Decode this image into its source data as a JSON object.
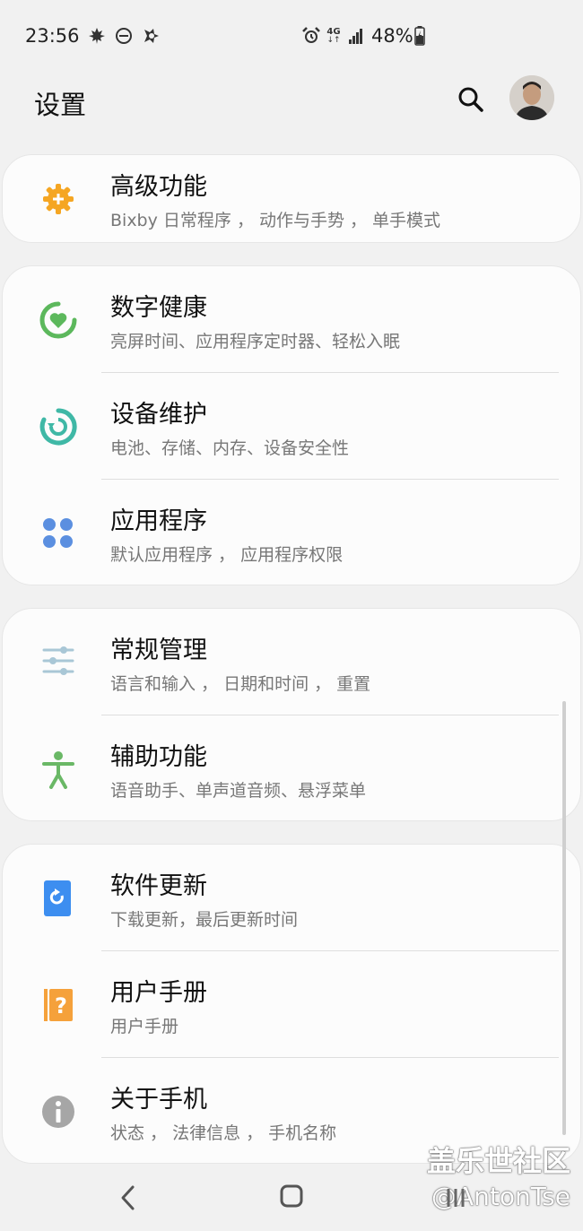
{
  "status_bar": {
    "time": "23:56",
    "network": "4G",
    "battery": "48%"
  },
  "header": {
    "title": "设置"
  },
  "cards": [
    {
      "items": [
        {
          "title": "高级功能",
          "subtitle": "Bixby 日常程序 ， 动作与手势 ， 单手模式",
          "icon": "gear-plus-icon",
          "color": "#f5a623"
        }
      ]
    },
    {
      "items": [
        {
          "title": "数字健康",
          "subtitle": "亮屏时间、应用程序定时器、轻松入眠",
          "icon": "heart-circle-icon",
          "color": "#5cb85c"
        },
        {
          "title": "设备维护",
          "subtitle": "电池、存储、内存、设备安全性",
          "icon": "refresh-circle-icon",
          "color": "#3fb8a6"
        },
        {
          "title": "应用程序",
          "subtitle": "默认应用程序 ， 应用程序权限",
          "icon": "apps-grid-icon",
          "color": "#5b8fe0"
        }
      ]
    },
    {
      "items": [
        {
          "title": "常规管理",
          "subtitle": "语言和输入 ， 日期和时间 ， 重置",
          "icon": "sliders-icon",
          "color": "#a9c7d6"
        },
        {
          "title": "辅助功能",
          "subtitle": "语音助手、单声道音频、悬浮菜单",
          "icon": "accessibility-icon",
          "color": "#6ab866"
        }
      ]
    },
    {
      "items": [
        {
          "title": "软件更新",
          "subtitle": "下载更新，最后更新时间",
          "icon": "software-update-icon",
          "color": "#3d8ef0"
        },
        {
          "title": "用户手册",
          "subtitle": "用户手册",
          "icon": "user-manual-icon",
          "color": "#f5a13b"
        },
        {
          "title": "关于手机",
          "subtitle": "状态 ， 法律信息 ， 手机名称",
          "icon": "info-icon",
          "color": "#a6a6a6"
        }
      ]
    }
  ],
  "watermark": {
    "line1": "盖乐世社区",
    "line2": "@AntonTse"
  }
}
